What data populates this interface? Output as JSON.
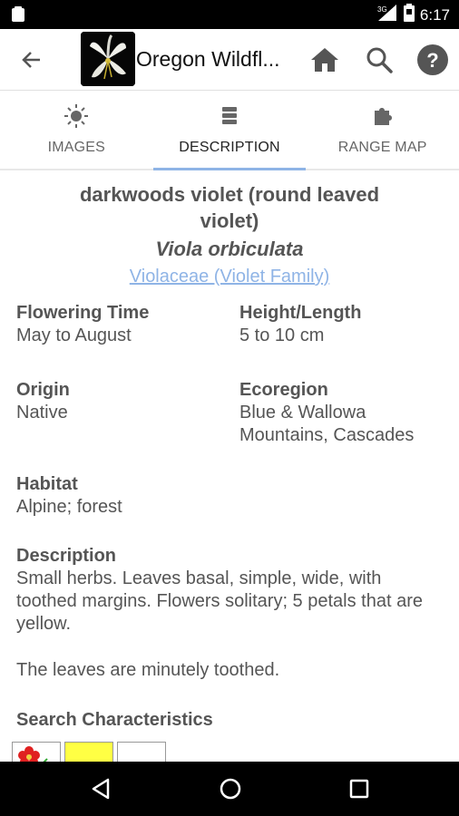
{
  "status_bar": {
    "time": "6:17",
    "network": "3G",
    "icons": [
      "notification-icon",
      "signal-icon",
      "battery-icon"
    ]
  },
  "app_bar": {
    "title": "Oregon Wildfl...",
    "back_icon": "back-arrow-icon",
    "actions": [
      "home-icon",
      "search-icon",
      "help-icon"
    ]
  },
  "tabs": [
    {
      "label": "IMAGES",
      "icon": "sun-icon",
      "active": false
    },
    {
      "label": "DESCRIPTION",
      "icon": "list-icon",
      "active": true
    },
    {
      "label": "RANGE MAP",
      "icon": "puzzle-icon",
      "active": false
    }
  ],
  "plant": {
    "common_name": "darkwoods violet (round leaved violet)",
    "scientific_name": "Viola orbiculata",
    "family": "Violaceae (Violet Family)"
  },
  "fields": {
    "flowering_time": {
      "label": "Flowering Time",
      "value": "May to August"
    },
    "height": {
      "label": "Height/Length",
      "value": "5 to 10 cm"
    },
    "origin": {
      "label": "Origin",
      "value": "Native"
    },
    "ecoregion": {
      "label": "Ecoregion",
      "value": "Blue & Wallowa Mountains, Cascades"
    },
    "habitat": {
      "label": "Habitat",
      "value": "Alpine; forest"
    },
    "description": {
      "label": "Description",
      "value": "Small herbs. Leaves basal, simple, wide, with toothed margins. Flowers solitary; 5 petals that are yellow.",
      "value2": "The leaves are minutely toothed."
    },
    "search_characteristics": {
      "label": "Search Characteristics"
    }
  },
  "swatches": [
    {
      "name": "flower-shape-icon",
      "color": "#ffffff"
    },
    {
      "name": "color-yellow",
      "color": "#ffff44"
    },
    {
      "name": "petal-count-icon",
      "color": "#ffffff"
    }
  ],
  "nav_bar": [
    "back-triangle-icon",
    "home-circle-icon",
    "recents-square-icon"
  ],
  "colors": {
    "accent": "#8fb4e6",
    "text": "#555555"
  }
}
